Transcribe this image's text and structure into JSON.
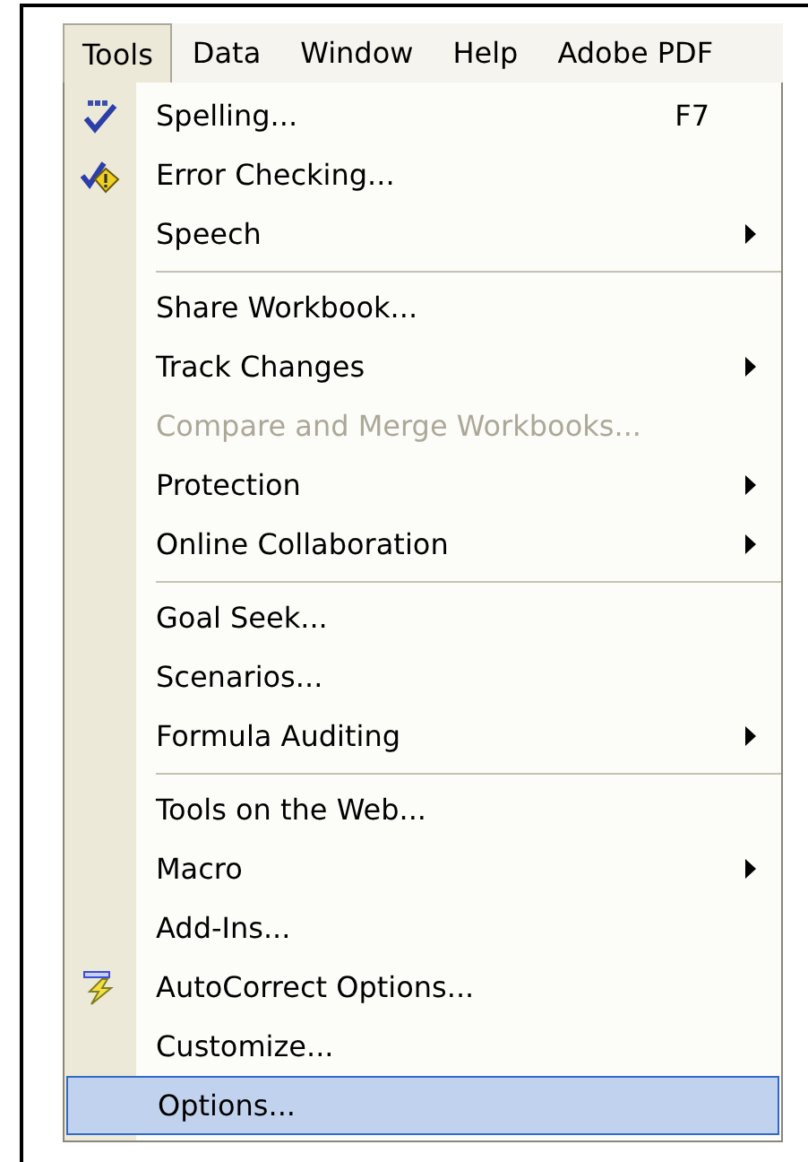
{
  "menu_bar": [
    {
      "label": "Tools",
      "selected": true
    },
    {
      "label": "Data",
      "selected": false
    },
    {
      "label": "Window",
      "selected": false
    },
    {
      "label": "Help",
      "selected": false
    },
    {
      "label": "Adobe PDF",
      "selected": false
    }
  ],
  "menu": {
    "items": [
      {
        "kind": "item",
        "label": "Spelling...",
        "shortcut": "F7",
        "submenu": false,
        "disabled": false,
        "selected": false
      },
      {
        "kind": "item",
        "label": "Error Checking...",
        "submenu": false,
        "disabled": false,
        "selected": false
      },
      {
        "kind": "item",
        "label": "Speech",
        "submenu": true,
        "disabled": false,
        "selected": false
      },
      {
        "kind": "separator"
      },
      {
        "kind": "item",
        "label": "Share Workbook...",
        "submenu": false,
        "disabled": false,
        "selected": false
      },
      {
        "kind": "item",
        "label": "Track Changes",
        "submenu": true,
        "disabled": false,
        "selected": false
      },
      {
        "kind": "item",
        "label": "Compare and Merge Workbooks...",
        "submenu": false,
        "disabled": true,
        "selected": false
      },
      {
        "kind": "item",
        "label": "Protection",
        "submenu": true,
        "disabled": false,
        "selected": false
      },
      {
        "kind": "item",
        "label": "Online Collaboration",
        "submenu": true,
        "disabled": false,
        "selected": false
      },
      {
        "kind": "separator"
      },
      {
        "kind": "item",
        "label": "Goal Seek...",
        "submenu": false,
        "disabled": false,
        "selected": false
      },
      {
        "kind": "item",
        "label": "Scenarios...",
        "submenu": false,
        "disabled": false,
        "selected": false
      },
      {
        "kind": "item",
        "label": "Formula Auditing",
        "submenu": true,
        "disabled": false,
        "selected": false
      },
      {
        "kind": "separator"
      },
      {
        "kind": "item",
        "label": "Tools on the Web...",
        "submenu": false,
        "disabled": false,
        "selected": false
      },
      {
        "kind": "item",
        "label": "Macro",
        "submenu": true,
        "disabled": false,
        "selected": false
      },
      {
        "kind": "item",
        "label": "Add-Ins...",
        "submenu": false,
        "disabled": false,
        "selected": false
      },
      {
        "kind": "item",
        "label": "AutoCorrect Options...",
        "submenu": false,
        "disabled": false,
        "selected": false
      },
      {
        "kind": "item",
        "label": "Customize...",
        "submenu": false,
        "disabled": false,
        "selected": false
      },
      {
        "kind": "item",
        "label": "Options...",
        "submenu": false,
        "disabled": false,
        "selected": true
      }
    ]
  }
}
